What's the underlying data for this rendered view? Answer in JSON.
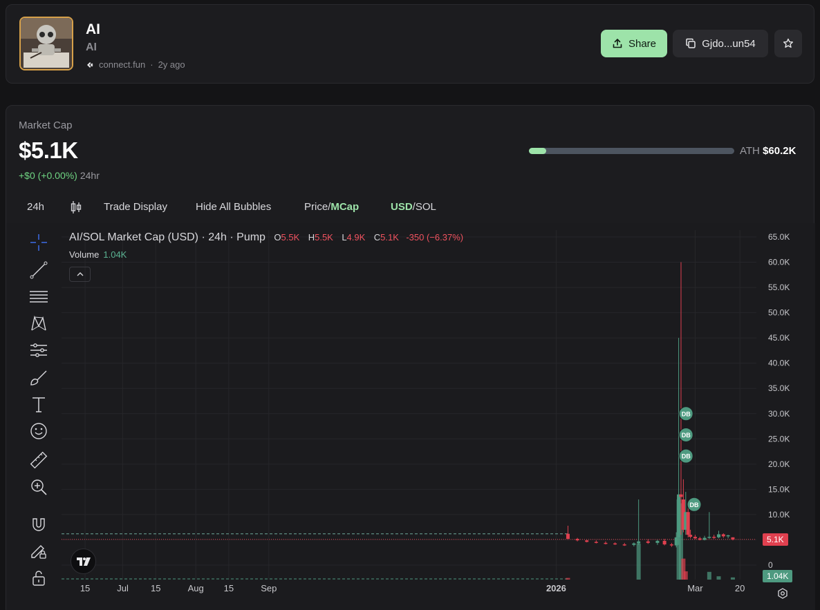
{
  "header": {
    "name": "AI",
    "symbol": "AI",
    "platform": "connect.fun",
    "age": "2y ago",
    "share_label": "Share",
    "address_label": "Gjdo...un54"
  },
  "market": {
    "label": "Market Cap",
    "value": "$5.1K",
    "change": "+$0 (+0.00%)",
    "period": "24hr",
    "ath_label": "ATH",
    "ath_value": "$60.2K",
    "ath_progress": 0.085
  },
  "toolbar": {
    "interval": "24h",
    "trade_display": "Trade Display",
    "hide_bubbles": "Hide All Bubbles",
    "price_label": "Price/",
    "mcap_label": "MCap",
    "usd_label": "USD",
    "sol_label": "/SOL"
  },
  "legend": {
    "title": "AI/SOL Market Cap (USD) · 24h · Pump",
    "o_key": "O",
    "o_val": "5.5K",
    "h_key": "H",
    "h_val": "5.5K",
    "l_key": "L",
    "l_val": "4.9K",
    "c_key": "C",
    "c_val": "5.1K",
    "change": "-350 (−6.37%)",
    "volume_label": "Volume",
    "volume_value": "1.04K"
  },
  "price_tags": {
    "last": "5.1K",
    "volume": "1.04K"
  },
  "colors": {
    "up": "#4e9a80",
    "down": "#e0404f",
    "accent": "#9de3a9",
    "bubble": "#4e9a80"
  },
  "icons": {
    "tools": [
      "crosshair-icon",
      "trend-line-icon",
      "fib-retracement-icon",
      "pattern-icon",
      "forecast-icon",
      "brush-icon",
      "text-icon",
      "emoji-icon",
      "ruler-icon",
      "zoom-in-icon",
      "magnet-icon",
      "lock-drawing-icon",
      "unlock-icon"
    ]
  },
  "chart_data": {
    "type": "candlestick",
    "y_axis_ticks": [
      "65.0K",
      "60.0K",
      "55.0K",
      "50.0K",
      "45.0K",
      "40.0K",
      "35.0K",
      "30.0K",
      "25.0K",
      "20.0K",
      "15.0K",
      "10.0K",
      "5.0K",
      "0"
    ],
    "x_axis_ticks": [
      "15",
      "Jul",
      "15",
      "Aug",
      "15",
      "Sep",
      "2026",
      "Mar",
      "20"
    ],
    "ylim": [
      0,
      65000
    ],
    "bubbles": [
      "DB",
      "DB",
      "DB",
      "DB"
    ],
    "candles": [
      {
        "x": "2026-01-06",
        "o": 6200,
        "h": 7800,
        "l": 5000,
        "c": 5200
      },
      {
        "x": "2026-01-10",
        "o": 5200,
        "h": 5400,
        "l": 4700,
        "c": 4900
      },
      {
        "x": "2026-01-14",
        "o": 4900,
        "h": 5000,
        "l": 4500,
        "c": 4600
      },
      {
        "x": "2026-01-18",
        "o": 4600,
        "h": 4900,
        "l": 4300,
        "c": 4400
      },
      {
        "x": "2026-01-22",
        "o": 4400,
        "h": 4700,
        "l": 4100,
        "c": 4300
      },
      {
        "x": "2026-01-26",
        "o": 4300,
        "h": 4500,
        "l": 4000,
        "c": 4100
      },
      {
        "x": "2026-01-30",
        "o": 4100,
        "h": 4400,
        "l": 3800,
        "c": 4000
      },
      {
        "x": "2026-02-03",
        "o": 4000,
        "h": 4500,
        "l": 3700,
        "c": 4300
      },
      {
        "x": "2026-02-05",
        "o": 4300,
        "h": 13000,
        "l": 4000,
        "c": 4700
      },
      {
        "x": "2026-02-09",
        "o": 4700,
        "h": 5100,
        "l": 4200,
        "c": 4400
      },
      {
        "x": "2026-02-13",
        "o": 4400,
        "h": 5000,
        "l": 4000,
        "c": 4800
      },
      {
        "x": "2026-02-16",
        "o": 4800,
        "h": 5200,
        "l": 3900,
        "c": 4100
      },
      {
        "x": "2026-02-19",
        "o": 4100,
        "h": 4400,
        "l": 3600,
        "c": 3900
      },
      {
        "x": "2026-02-21",
        "o": 3900,
        "h": 6500,
        "l": 3500,
        "c": 5500
      },
      {
        "x": "2026-02-22",
        "o": 5500,
        "h": 45000,
        "l": 4000,
        "c": 14000
      },
      {
        "x": "2026-02-23",
        "o": 14000,
        "h": 60000,
        "l": 6000,
        "c": 13500
      },
      {
        "x": "2026-02-24",
        "o": 13000,
        "h": 17000,
        "l": 6500,
        "c": 7000
      },
      {
        "x": "2026-02-25",
        "o": 7000,
        "h": 14500,
        "l": 6000,
        "c": 10500
      },
      {
        "x": "2026-02-26",
        "o": 10500,
        "h": 11500,
        "l": 5500,
        "c": 6000
      },
      {
        "x": "2026-02-27",
        "o": 6000,
        "h": 7000,
        "l": 5300,
        "c": 5600
      },
      {
        "x": "2026-03-01",
        "o": 5600,
        "h": 6000,
        "l": 5100,
        "c": 5300
      },
      {
        "x": "2026-03-03",
        "o": 5300,
        "h": 5600,
        "l": 4900,
        "c": 5000
      },
      {
        "x": "2026-03-05",
        "o": 5000,
        "h": 5800,
        "l": 4900,
        "c": 5400
      },
      {
        "x": "2026-03-07",
        "o": 5400,
        "h": 10500,
        "l": 5200,
        "c": 5600
      },
      {
        "x": "2026-03-09",
        "o": 5600,
        "h": 6000,
        "l": 5200,
        "c": 5500
      },
      {
        "x": "2026-03-11",
        "o": 5500,
        "h": 6800,
        "l": 5300,
        "c": 6100
      },
      {
        "x": "2026-03-13",
        "o": 6100,
        "h": 6300,
        "l": 5400,
        "c": 5700
      },
      {
        "x": "2026-03-15",
        "o": 5700,
        "h": 6000,
        "l": 5300,
        "c": 5900
      },
      {
        "x": "2026-03-17",
        "o": 5500,
        "h": 5500,
        "l": 4900,
        "c": 5100
      }
    ],
    "volume": [
      {
        "x": "2026-01-06",
        "v": 300,
        "dir": "down"
      },
      {
        "x": "2026-02-05",
        "v": 6500,
        "dir": "up"
      },
      {
        "x": "2026-02-22",
        "v": 14500,
        "dir": "up"
      },
      {
        "x": "2026-02-23",
        "v": 13800,
        "dir": "up"
      },
      {
        "x": "2026-02-24",
        "v": 3800,
        "dir": "down"
      },
      {
        "x": "2026-02-25",
        "v": 1500,
        "dir": "down"
      },
      {
        "x": "2026-03-07",
        "v": 1400,
        "dir": "up"
      },
      {
        "x": "2026-03-11",
        "v": 600,
        "dir": "up"
      },
      {
        "x": "2026-03-17",
        "v": 400,
        "dir": "up"
      }
    ]
  }
}
